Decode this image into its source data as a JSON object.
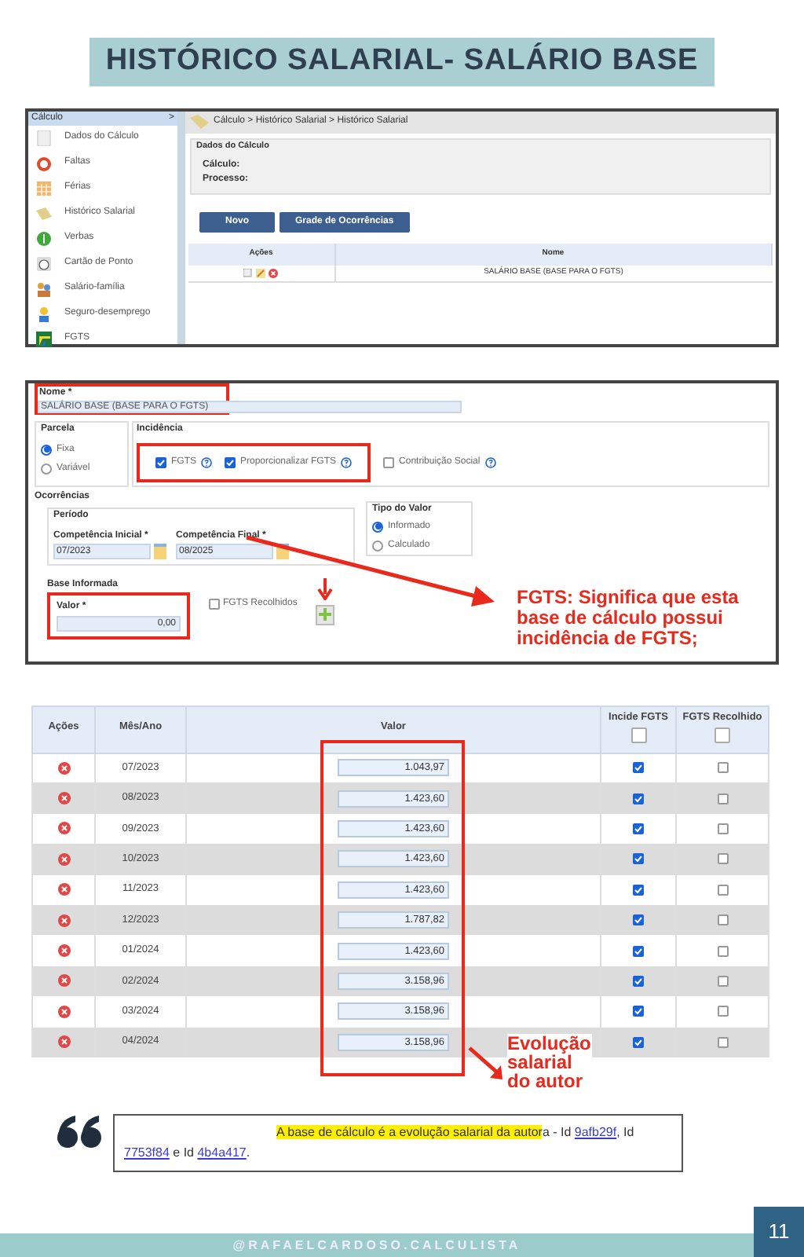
{
  "title": "HISTÓRICO SALARIAL- SALÁRIO BASE",
  "app": {
    "sidebar": {
      "header": "Cálculo",
      "toggle": ">",
      "items": [
        {
          "label": "Dados do Cálculo"
        },
        {
          "label": "Faltas"
        },
        {
          "label": "Férias"
        },
        {
          "label": "Histórico Salarial"
        },
        {
          "label": "Verbas"
        },
        {
          "label": "Cartão de Ponto"
        },
        {
          "label": "Salário-família"
        },
        {
          "label": "Seguro-desemprego"
        },
        {
          "label": "FGTS"
        }
      ]
    },
    "breadcrumb": "Cálculo > Histórico Salarial > Histórico Salarial",
    "section_title": "Dados do Cálculo",
    "fields": [
      "Cálculo:",
      "Processo:"
    ],
    "buttons": [
      "Novo",
      "Grade de Ocorrências"
    ],
    "table": {
      "columns": [
        "Ações",
        "Nome"
      ],
      "rows": [
        {
          "name": "SALÁRIO BASE (BASE PARA O FGTS)"
        }
      ]
    }
  },
  "form": {
    "nome": {
      "label": "Nome *",
      "value": "SALÁRIO BASE (BASE PARA O FGTS)"
    },
    "parcela": {
      "title": "Parcela",
      "options": [
        {
          "label": "Fixa",
          "selected": true
        },
        {
          "label": "Variável",
          "selected": false
        }
      ]
    },
    "incidencia": {
      "title": "Incidência",
      "options": [
        {
          "label": "FGTS",
          "checked": true
        },
        {
          "label": "Proporcionalizar FGTS",
          "checked": true
        },
        {
          "label": "Contribuição Social",
          "checked": false
        }
      ]
    },
    "ocorrencias": "Ocorrências",
    "periodo": "Período",
    "competencias": [
      {
        "label": "Competência Inicial *",
        "value": "07/2023"
      },
      {
        "label": "Competência Final *",
        "value": "08/2025"
      }
    ],
    "tipo_valor": {
      "title": "Tipo do Valor",
      "options": [
        {
          "label": "Informado",
          "selected": true
        },
        {
          "label": "Calculado",
          "selected": false
        }
      ]
    },
    "base_informada": {
      "title": "Base Informada",
      "label": "Valor *",
      "value": "0,00"
    },
    "fgts_recolhidos": {
      "label": "FGTS Recolhidos",
      "checked": false
    },
    "note": "FGTS: Significa que esta base de cálculo possui incidência de FGTS;"
  },
  "grid": {
    "columns": [
      "Ações",
      "Mês/Ano",
      "Valor",
      "Incide FGTS",
      "FGTS Recolhido"
    ],
    "header_checks": [
      {
        "checked": false
      },
      {
        "checked": false
      }
    ],
    "rows": [
      {
        "month": "07/2023",
        "value": "1.043,97",
        "incide": true,
        "recolhido": false
      },
      {
        "month": "08/2023",
        "value": "1.423,60",
        "incide": true,
        "recolhido": false
      },
      {
        "month": "09/2023",
        "value": "1.423,60",
        "incide": true,
        "recolhido": false
      },
      {
        "month": "10/2023",
        "value": "1.423,60",
        "incide": true,
        "recolhido": false
      },
      {
        "month": "11/2023",
        "value": "1.423,60",
        "incide": true,
        "recolhido": false
      },
      {
        "month": "12/2023",
        "value": "1.787,82",
        "incide": true,
        "recolhido": false
      },
      {
        "month": "01/2024",
        "value": "1.423,60",
        "incide": true,
        "recolhido": false
      },
      {
        "month": "02/2024",
        "value": "3.158,96",
        "incide": true,
        "recolhido": false
      },
      {
        "month": "03/2024",
        "value": "3.158,96",
        "incide": true,
        "recolhido": false
      },
      {
        "month": "04/2024",
        "value": "3.158,96",
        "incide": true,
        "recolhido": false
      }
    ],
    "note": "Evolução salarial do autor"
  },
  "quote": [
    {
      "kind": "highlight",
      "text": "A base de cálculo é a evolução salarial da autor"
    },
    {
      "kind": "plain",
      "text": "a - Id "
    },
    {
      "kind": "link",
      "text": "9afb29f"
    },
    {
      "kind": "plain",
      "text": ", Id "
    },
    {
      "kind": "link",
      "text": "7753f84"
    },
    {
      "kind": "plain",
      "text": " e Id "
    },
    {
      "kind": "link",
      "text": "4b4a417"
    },
    {
      "kind": "plain",
      "text": "."
    }
  ],
  "footer": "@RAFAELCARDOSO.CALCULISTA",
  "page_number": "11"
}
